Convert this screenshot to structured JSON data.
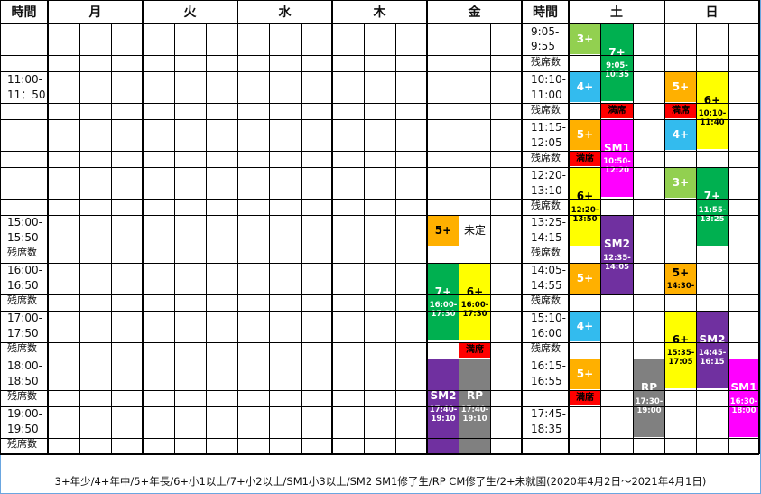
{
  "header": {
    "time": "時間",
    "days": [
      "月",
      "火",
      "水",
      "木",
      "金"
    ],
    "time2": "時間",
    "sat": "土",
    "sun": "日"
  },
  "left_slots": [
    {
      "line1": "",
      "line2": "",
      "remain": ""
    },
    {
      "line1": "11:00-",
      "line2": "11：50",
      "remain": ""
    },
    {
      "line1": "",
      "line2": "",
      "remain": ""
    },
    {
      "line1": "",
      "line2": "",
      "remain": ""
    },
    {
      "line1": "15:00-",
      "line2": "15:50",
      "remain": "残席数"
    },
    {
      "line1": "16:00-",
      "line2": "16:50",
      "remain": "残席数"
    },
    {
      "line1": "17:00-",
      "line2": "17:50",
      "remain": "残席数"
    },
    {
      "line1": "18:00-",
      "line2": "18:50",
      "remain": "残席数"
    },
    {
      "line1": "19:00-",
      "line2": "19:50",
      "remain": "残席数"
    }
  ],
  "right_slots": [
    {
      "line1": "9:05-",
      "line2": "9:55",
      "remain": "残席数"
    },
    {
      "line1": "10:10-",
      "line2": "11:00",
      "remain": "残席数"
    },
    {
      "line1": "11:15-",
      "line2": "12:05",
      "remain": "残席数"
    },
    {
      "line1": "12:20-",
      "line2": "13:10",
      "remain": "残席数"
    },
    {
      "line1": "13:25-",
      "line2": "14:15",
      "remain": "残席数"
    },
    {
      "line1": "14:05-",
      "line2": "14:55",
      "remain": "残席数"
    },
    {
      "line1": "15:10-",
      "line2": "16:00",
      "remain": "残席数"
    },
    {
      "line1": "16:15-",
      "line2": "16:55",
      "remain": ""
    },
    {
      "line1": "17:45-",
      "line2": "18:35",
      "remain": ""
    }
  ],
  "colors": {
    "plus3": "#92d050",
    "plus4": "#33bbee",
    "plus5": "#ffb000",
    "plus6": "#ffff00",
    "plus7": "#00b050",
    "sm1": "#ff00ff",
    "sm2": "#7030a0",
    "rp": "#808080",
    "full": "#ff0000",
    "undecided": "#ffffff"
  },
  "blocks": [
    {
      "id": "fri-5plus",
      "label": "5+",
      "time": "",
      "color": "plus5",
      "dark": false
    },
    {
      "id": "fri-undecided",
      "label": "未定",
      "time": "",
      "color": "undecided",
      "dark": false
    },
    {
      "id": "fri-7plus",
      "label": "7+",
      "time": "16:00-\n17:30",
      "color": "plus7",
      "dark": true
    },
    {
      "id": "fri-6plus",
      "label": "6+",
      "time": "16:00-\n17:30",
      "color": "plus6",
      "dark": false
    },
    {
      "id": "fri-full",
      "label": "満席",
      "time": "",
      "color": "full",
      "dark": false
    },
    {
      "id": "fri-sm2",
      "label": "SM2",
      "time": "17:40-\n19:10",
      "color": "sm2",
      "dark": true
    },
    {
      "id": "fri-rp",
      "label": "RP",
      "time": "17:40-\n19:10",
      "color": "rp",
      "dark": true
    },
    {
      "id": "sat-3plus",
      "label": "3+",
      "time": "",
      "color": "plus3",
      "dark": true
    },
    {
      "id": "sat-7plus",
      "label": "7+",
      "time": "9:05-\n10:35",
      "color": "plus7",
      "dark": true
    },
    {
      "id": "sat-4plus-a",
      "label": "4+",
      "time": "",
      "color": "plus4",
      "dark": true
    },
    {
      "id": "sat-full-a",
      "label": "満席",
      "time": "",
      "color": "full",
      "dark": false
    },
    {
      "id": "sat-5plus-a",
      "label": "5+",
      "time": "",
      "color": "plus5",
      "dark": true
    },
    {
      "id": "sat-sm1",
      "label": "SM1",
      "time": "10:50-\n12:20",
      "color": "sm1",
      "dark": true
    },
    {
      "id": "sat-full-b",
      "label": "満席",
      "time": "",
      "color": "full",
      "dark": false
    },
    {
      "id": "sat-6plus",
      "label": "6+",
      "time": "12:20-\n13:50",
      "color": "plus6",
      "dark": false
    },
    {
      "id": "sat-sm2",
      "label": "SM2",
      "time": "12:35-\n14:05",
      "color": "sm2",
      "dark": true
    },
    {
      "id": "sat-5plus-b",
      "label": "5+",
      "time": "",
      "color": "plus5",
      "dark": true
    },
    {
      "id": "sat-4plus-b",
      "label": "4+",
      "time": "",
      "color": "plus4",
      "dark": true
    },
    {
      "id": "sat-5plus-c",
      "label": "5+",
      "time": "",
      "color": "plus5",
      "dark": true
    },
    {
      "id": "sat-full-c",
      "label": "満席",
      "time": "",
      "color": "full",
      "dark": false
    },
    {
      "id": "sat-rp",
      "label": "RP",
      "time": "17:30-\n19:00",
      "color": "rp",
      "dark": true
    },
    {
      "id": "sun-5plus-a",
      "label": "5+",
      "time": "",
      "color": "plus5",
      "dark": true
    },
    {
      "id": "sun-6plus-a",
      "label": "6+",
      "time": "10:10-\n11:40",
      "color": "plus6",
      "dark": false
    },
    {
      "id": "sun-full",
      "label": "満席",
      "time": "",
      "color": "full",
      "dark": false
    },
    {
      "id": "sun-4plus",
      "label": "4+",
      "time": "",
      "color": "plus4",
      "dark": true
    },
    {
      "id": "sun-3plus",
      "label": "3+",
      "time": "",
      "color": "plus3",
      "dark": true
    },
    {
      "id": "sun-7plus",
      "label": "7+",
      "time": "11:55-\n13:25",
      "color": "plus7",
      "dark": true
    },
    {
      "id": "sun-5plus-b",
      "label": "5+",
      "time": "14:30-",
      "color": "plus5",
      "dark": false
    },
    {
      "id": "sun-6plus-b",
      "label": "6+",
      "time": "15:35-\n17:05",
      "color": "plus6",
      "dark": false
    },
    {
      "id": "sun-sm2",
      "label": "SM2",
      "time": "14:45-\n16:15",
      "color": "sm2",
      "dark": true
    },
    {
      "id": "sun-sm1",
      "label": "SM1",
      "time": "16:30-\n18:00",
      "color": "sm1",
      "dark": true
    }
  ],
  "footer": {
    "note": "3+年少/4+年中/5+年長/6+小1以上/7+小2以上/SM1小3以上/SM2 SM1修了生/RP CM修了生/2+未就園(2020年4月2日～2021年4月1日)"
  }
}
